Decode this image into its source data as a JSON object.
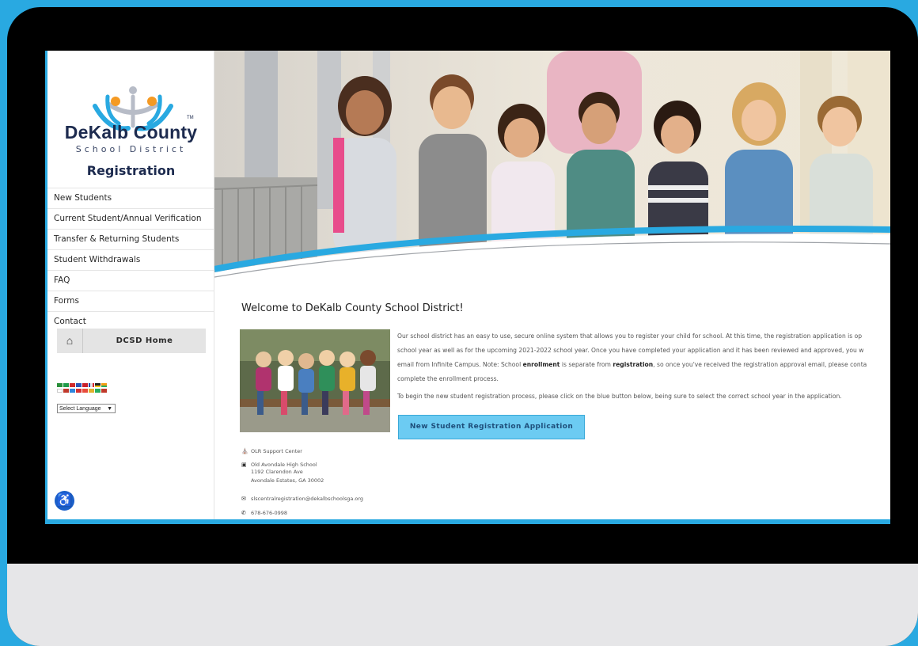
{
  "brand": {
    "name": "DeKalb County",
    "subtitle": "School District",
    "trademark": "TM",
    "page_title": "Registration"
  },
  "nav": {
    "items": [
      {
        "label": "New Students"
      },
      {
        "label": "Current Student/Annual Verification"
      },
      {
        "label": "Transfer & Returning Students"
      },
      {
        "label": "Student Withdrawals"
      },
      {
        "label": "FAQ"
      },
      {
        "label": "Forms"
      },
      {
        "label": "Contact"
      }
    ],
    "home_label": "DCSD Home"
  },
  "language": {
    "select_label": "Select Language"
  },
  "main": {
    "welcome_title": "Welcome to DeKalb County School District!",
    "paragraph1_line1": "Our school district has an easy to use, secure online system that allows you to register your child for school. At this time, the registration application is op",
    "paragraph1_line2": "school year as well as for the upcoming 2021-2022 school year. Once you have completed your application and it has been reviewed and approved, you w",
    "paragraph1_line3_a": "email from Infinite Campus. Note: School ",
    "paragraph1_line3_b": "enrollment",
    "paragraph1_line3_c": " is separate from ",
    "paragraph1_line3_d": "registration",
    "paragraph1_line3_e": ", so once you've received the registration approval email, please conta",
    "paragraph1_line4": "complete the enrollment process.",
    "paragraph2": "To begin the new student registration process, please click on the blue button below, being sure to select the correct school year in the application.",
    "cta_label": "New Student Registration Application"
  },
  "contact": {
    "support_center": "OLR Support Center",
    "address_line1": "Old Avondale High School",
    "address_line2": "1192 Clarendon Ave",
    "address_line3": "Avondale Estates, GA 30002",
    "email": "slscentralregistration@dekalbschoolsga.org",
    "phone": "678-676-0998"
  },
  "colors": {
    "accent": "#29a9e1",
    "navy": "#1d2b4f",
    "button": "#6ccbf2"
  }
}
